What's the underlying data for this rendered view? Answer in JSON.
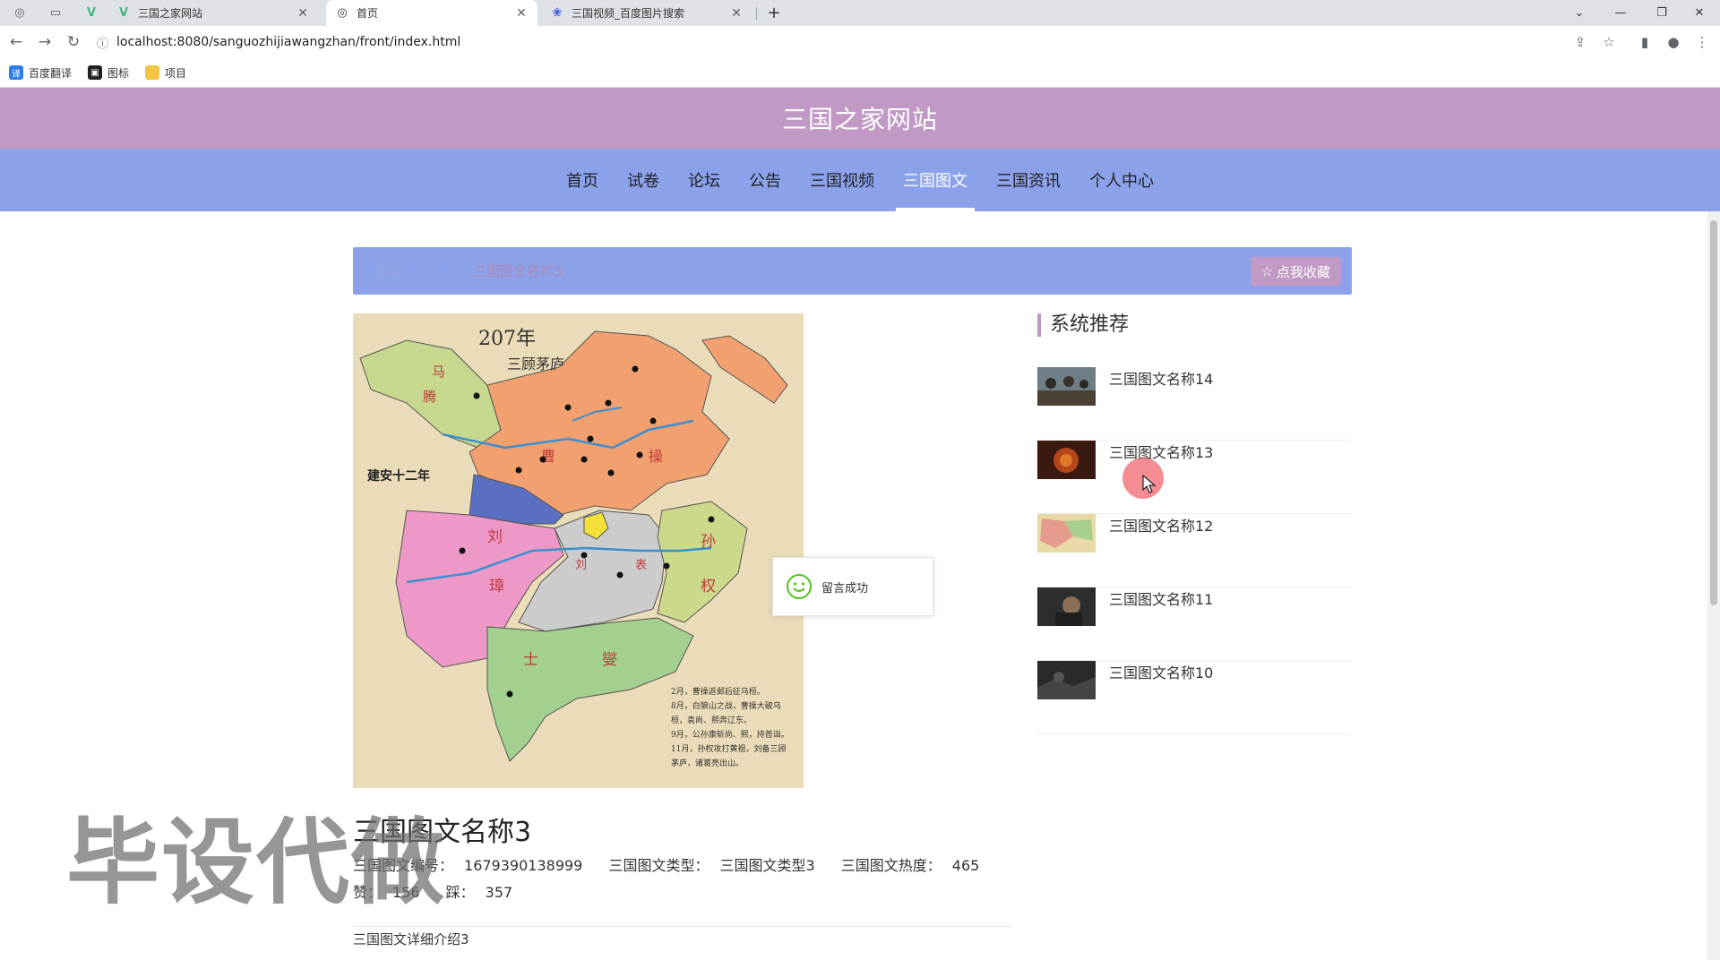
{
  "browser": {
    "tabs": [
      {
        "title": "三国之家网站",
        "icon": "vue-icon",
        "active": false
      },
      {
        "title": "首页",
        "icon": "globe-icon",
        "active": true
      },
      {
        "title": "三国视频_百度图片搜索",
        "icon": "baidu-icon",
        "active": false
      }
    ],
    "url": "localhost:8080/sanguozhijiawangzhan/front/index.html",
    "bookmarks": [
      "百度翻译",
      "图标",
      "项目"
    ]
  },
  "site": {
    "title": "三国之家网站",
    "nav": [
      "首页",
      "试卷",
      "论坛",
      "公告",
      "三国视频",
      "三国图文",
      "三国资讯",
      "个人中心"
    ],
    "nav_active": "三国图文"
  },
  "breadcrumb": {
    "home": "首页",
    "sep": "/",
    "current": "三国图文名称3",
    "favorite_label": "点我收藏"
  },
  "map": {
    "year": "207年",
    "event": "三顾茅庐",
    "era": "建安十二年",
    "regions": [
      "马",
      "腾",
      "曹",
      "操",
      "刘",
      "璋",
      "孙",
      "权",
      "刘",
      "表",
      "士",
      "燮"
    ],
    "notes": [
      "2月，曹操返邺后征乌桓。",
      "8月，白狼山之战，曹操大破乌",
      "桓，袁尚、熙奔辽东。",
      "9月，公孙康斩尚、熙，持首诣。",
      "11月，孙权攻打黄祖，刘备三顾",
      "茅庐，诸葛亮出山。"
    ]
  },
  "detail": {
    "title": "三国图文名称3",
    "meta": [
      {
        "label": "三国图文编号：",
        "value": "1679390138999"
      },
      {
        "label": "三国图文类型：",
        "value": "三国图文类型3"
      },
      {
        "label": "三国图文热度：",
        "value": "465"
      },
      {
        "label": "赞：",
        "value": "156"
      },
      {
        "label": "踩：",
        "value": "357"
      }
    ],
    "desc": "三国图文详细介绍3"
  },
  "toast": {
    "text": "留言成功"
  },
  "recommend": {
    "heading": "系统推荐",
    "items": [
      {
        "label": "三国图文名称14"
      },
      {
        "label": "三国图文名称13"
      },
      {
        "label": "三国图文名称12"
      },
      {
        "label": "三国图文名称11"
      },
      {
        "label": "三国图文名称10"
      }
    ]
  },
  "watermark": "毕设代做",
  "colors": {
    "header": "#c09ac5",
    "nav": "#8ba1ea",
    "accent": "#c09ac5"
  }
}
